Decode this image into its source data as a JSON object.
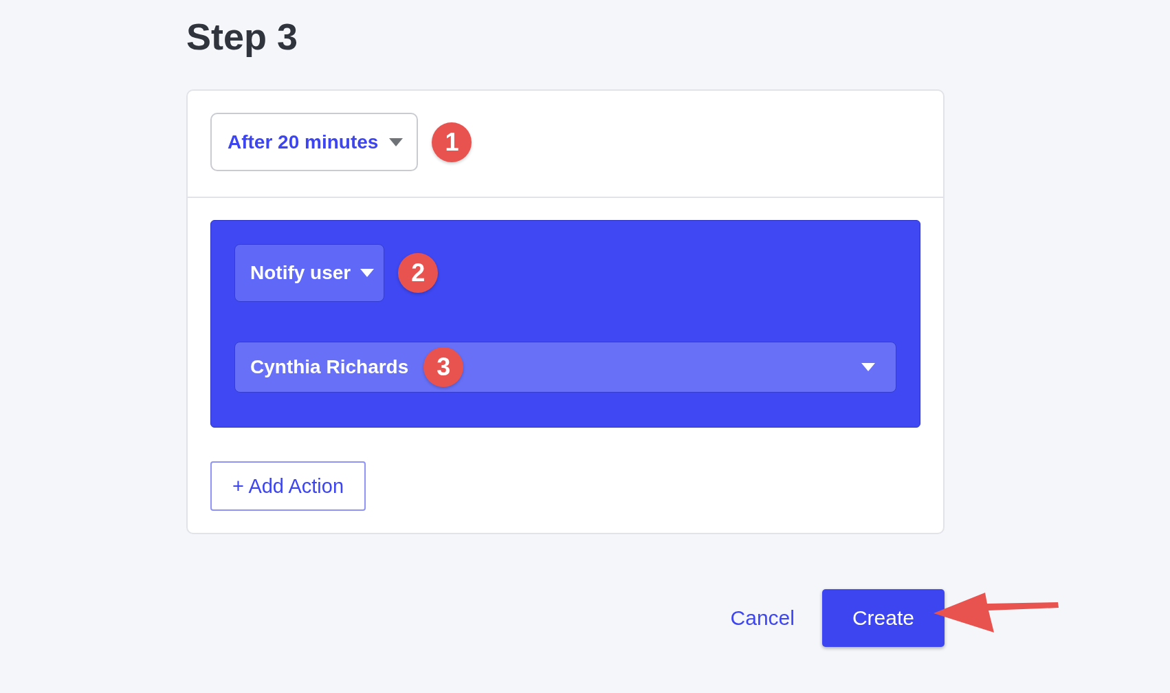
{
  "heading": "Step 3",
  "trigger": {
    "value": "After 20 minutes",
    "marker": "1"
  },
  "action": {
    "type": "Notify user",
    "type_marker": "2",
    "recipient": "Cynthia Richards",
    "recipient_marker": "3"
  },
  "add_action": "+ Add Action",
  "buttons": [
    {
      "label": "Cancel",
      "kind": "link"
    },
    {
      "label": "Create",
      "kind": "primary"
    }
  ]
}
